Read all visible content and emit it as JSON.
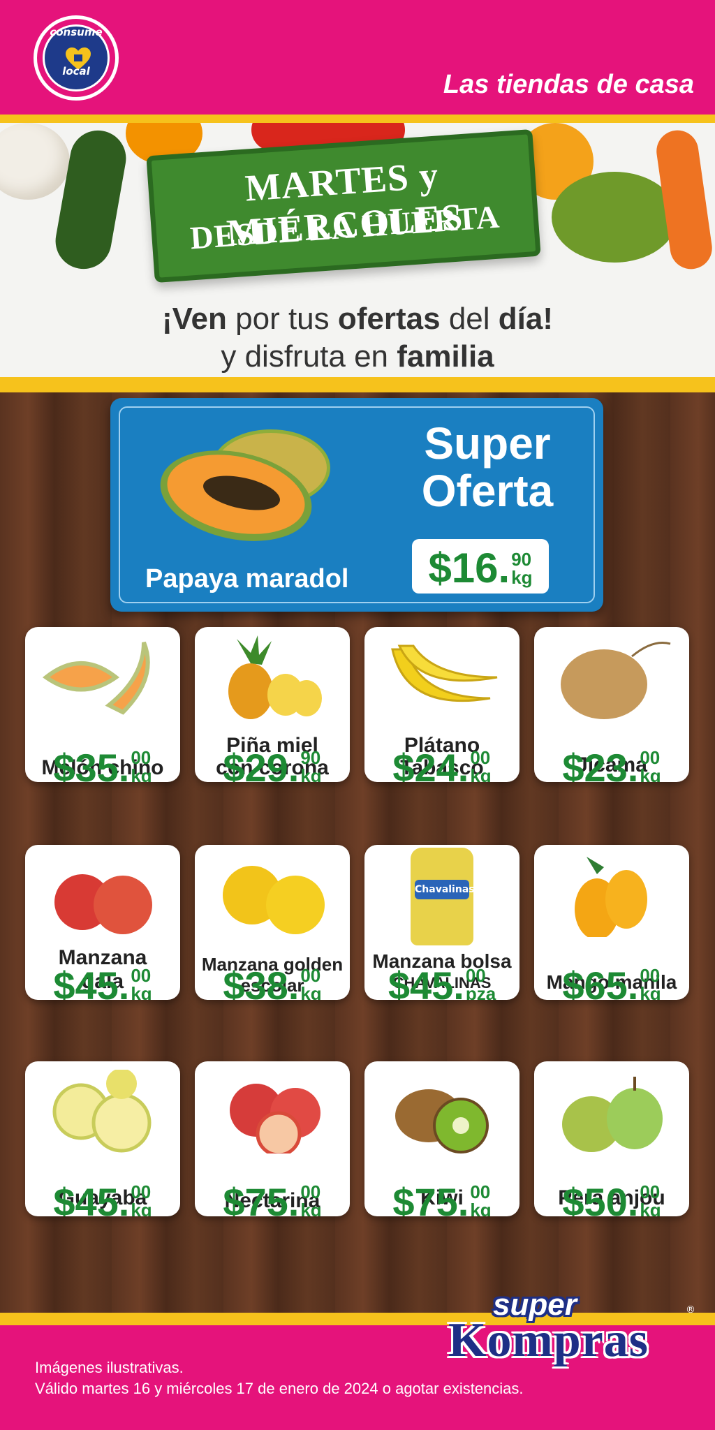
{
  "header": {
    "badge_top": "consume",
    "badge_bottom": "local",
    "tagline": "Las tiendas de casa"
  },
  "hero": {
    "sign_line1": "MARTES y MIÉRCOLES",
    "sign_line2": "DESDE LA HUERTA",
    "line1_a": "¡Ven",
    "line1_b": " por tus ",
    "line1_c": "ofertas",
    "line1_d": " del ",
    "line1_e": "día!",
    "line2_a": "y disfruta en ",
    "line2_b": "familia"
  },
  "super_offer": {
    "title1": "Super",
    "title2": "Oferta",
    "product": "Papaya maradol",
    "price_main": "$16.",
    "price_cents": "90",
    "price_unit": "kg"
  },
  "products": [
    {
      "name1": "Melón chino",
      "name2": "",
      "price_main": "$35.",
      "price_cents": "00",
      "price_unit": "kg"
    },
    {
      "name1": "Piña miel",
      "name2": "con corona",
      "price_main": "$29.",
      "price_cents": "90",
      "price_unit": "kg"
    },
    {
      "name1": "Plátano",
      "name2": "Tabasco",
      "price_main": "$24.",
      "price_cents": "00",
      "price_unit": "kg"
    },
    {
      "name1": "Jícama",
      "name2": "",
      "price_main": "$23.",
      "price_cents": "00",
      "price_unit": "kg"
    },
    {
      "name1": "Manzana",
      "name2": "gala",
      "price_main": "$45.",
      "price_cents": "00",
      "price_unit": "kg"
    },
    {
      "name1": "Manzana golden",
      "name2": "escolar",
      "price_main": "$38.",
      "price_cents": "00",
      "price_unit": "kg"
    },
    {
      "name1": "Manzana bolsa",
      "name2": "CHAVALINAS",
      "price_main": "$45.",
      "price_cents": "00",
      "price_unit": "pza",
      "bag_label": "Chavalinas"
    },
    {
      "name1": "Mango manila",
      "name2": "",
      "price_main": "$65.",
      "price_cents": "00",
      "price_unit": "kg"
    },
    {
      "name1": "Guayaba",
      "name2": "",
      "price_main": "$45.",
      "price_cents": "00",
      "price_unit": "kg"
    },
    {
      "name1": "Nectarina",
      "name2": "",
      "price_main": "$75.",
      "price_cents": "00",
      "price_unit": "kg"
    },
    {
      "name1": "Kiwi",
      "name2": "",
      "price_main": "$75.",
      "price_cents": "00",
      "price_unit": "kg"
    },
    {
      "name1": "Pera anjou",
      "name2": "",
      "price_main": "$50.",
      "price_cents": "00",
      "price_unit": "kg"
    }
  ],
  "footer": {
    "logo_top": "super",
    "logo_main": "Kompras",
    "logo_reg": "®",
    "disclaimer1": "Imágenes ilustrativas.",
    "disclaimer2": "Válido martes 16 y miércoles 17 de enero de 2024 o agotar existencias."
  },
  "colors": {
    "brand_pink": "#e5137b",
    "brand_yellow": "#f6c21c",
    "offer_blue": "#1a7fc1",
    "price_green": "#1d8a34",
    "logo_navy": "#1e2f86"
  }
}
